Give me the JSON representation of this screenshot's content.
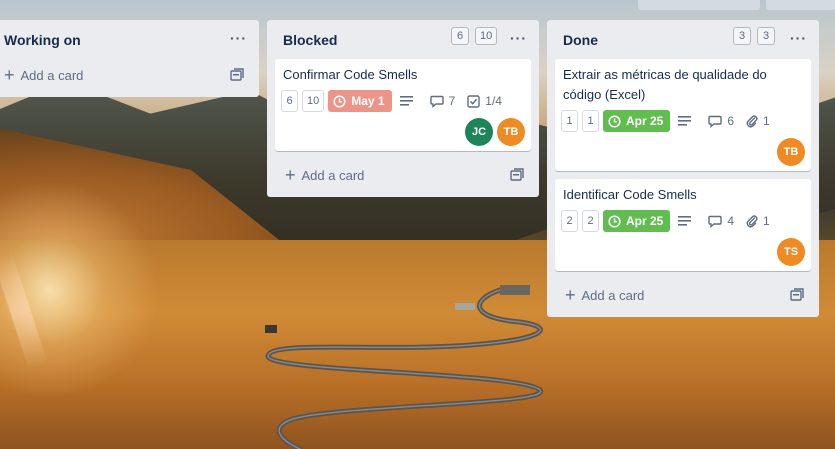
{
  "lists": [
    {
      "title": "Working on",
      "add_card_label": "Add a card"
    },
    {
      "title": "Blocked",
      "counts": [
        "6",
        "10"
      ],
      "cards": [
        {
          "title": "Confirmar Code Smells",
          "mini_counts": [
            "6",
            "10"
          ],
          "due": "May 1",
          "due_status": "overdue",
          "comments": "7",
          "checklist": "1/4",
          "members": [
            "JC",
            "TB"
          ]
        }
      ],
      "add_card_label": "Add a card"
    },
    {
      "title": "Done",
      "counts": [
        "3",
        "3"
      ],
      "cards": [
        {
          "title": "Extrair as métricas de qualidade do código (Excel)",
          "mini_counts": [
            "1",
            "1"
          ],
          "due": "Apr 25",
          "due_status": "complete",
          "comments": "6",
          "attachments": "1",
          "members": [
            "TB"
          ]
        },
        {
          "title": "Identificar Code Smells",
          "mini_counts": [
            "2",
            "2"
          ],
          "due": "Apr 25",
          "due_status": "complete",
          "comments": "4",
          "attachments": "1",
          "members": [
            "TS"
          ]
        }
      ],
      "add_card_label": "Add a card"
    }
  ],
  "member_colors": {
    "JC": "#1f845a",
    "TB": "#f08a24",
    "TS": "#f08a24"
  },
  "colors": {
    "list_bg": "#ebecf0",
    "due_overdue": "#ec9488",
    "due_complete": "#61bd4f"
  },
  "icons": {
    "menu": "ellipsis-icon",
    "due": "clock-icon",
    "description": "description-lines-icon",
    "comments": "comment-bubble-icon",
    "checklist": "checkbox-icon",
    "attachments": "paperclip-icon",
    "template": "card-template-icon",
    "add": "plus-icon"
  }
}
